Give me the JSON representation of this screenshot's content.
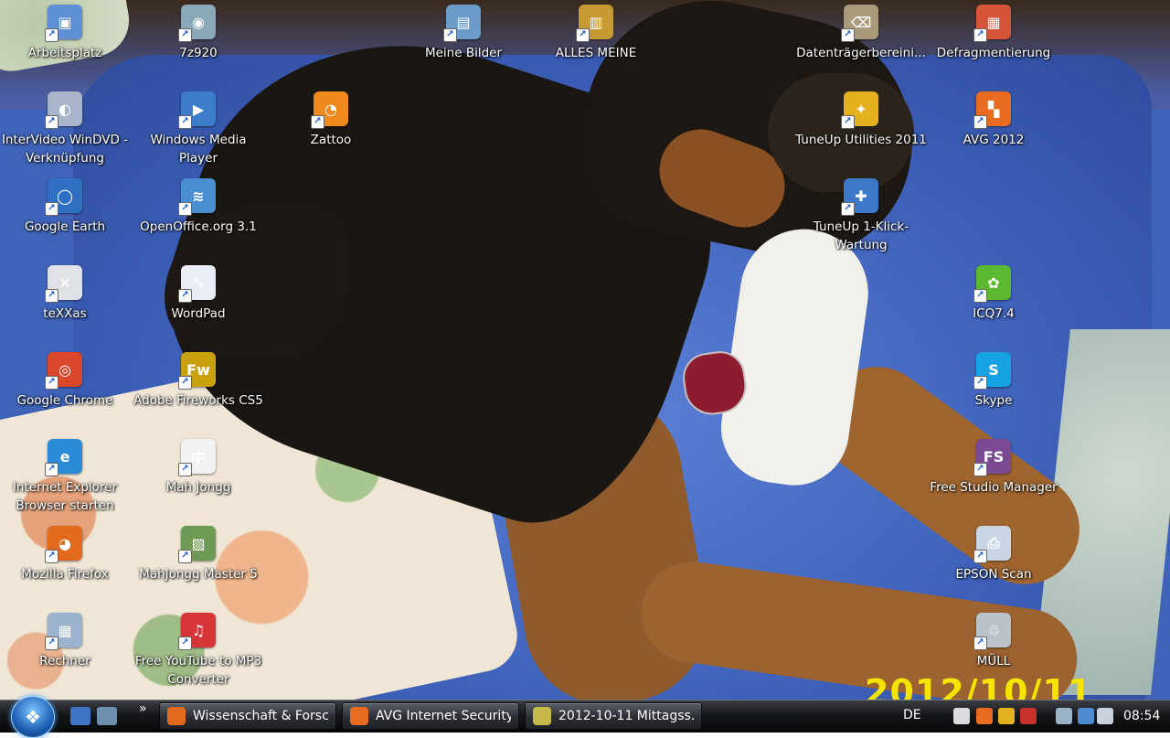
{
  "desktop": {
    "icons": [
      {
        "label": "Arbeitsplatz",
        "icon": "computer-icon",
        "color": "#5f8fd4",
        "glyph": "▣"
      },
      {
        "label": "7z920",
        "icon": "archive-installer-icon",
        "color": "#8aa8b8",
        "glyph": "◉"
      },
      {
        "label": "Meine Bilder",
        "icon": "pictures-folder-icon",
        "color": "#6a9bc9",
        "glyph": "▤"
      },
      {
        "label": "ALLES MEINE",
        "icon": "folder-icon",
        "color": "#c79a34",
        "glyph": "▥"
      },
      {
        "label": "Datenträgerbereini...",
        "icon": "disk-cleanup-icon",
        "color": "#a99a7c",
        "glyph": "⌫"
      },
      {
        "label": "Defragmentierung",
        "icon": "defragment-icon",
        "color": "#d6553a",
        "glyph": "▦"
      },
      {
        "label": "InterVideo WinDVD - Verknüpfung",
        "icon": "dvd-player-icon",
        "color": "#a7b4c9",
        "glyph": "◐"
      },
      {
        "label": "Windows Media Player",
        "icon": "media-player-icon",
        "color": "#3d7cc9",
        "glyph": "▶"
      },
      {
        "label": "Zattoo",
        "icon": "tv-icon",
        "color": "#f08a1c",
        "glyph": "◔"
      },
      {
        "label": "TuneUp Utilities 2011",
        "icon": "tuneup-icon",
        "color": "#e3b21e",
        "glyph": "✦"
      },
      {
        "label": "AVG 2012",
        "icon": "antivirus-icon",
        "color": "#e86b1f",
        "glyph": "▚"
      },
      {
        "label": "Google Earth",
        "icon": "globe-icon",
        "color": "#2f6fc4",
        "glyph": "◯"
      },
      {
        "label": "OpenOffice.org 3.1",
        "icon": "office-suite-icon",
        "color": "#4a8fd1",
        "glyph": "≋"
      },
      {
        "label": "TuneUp 1-Klick-Wartung",
        "icon": "maintenance-icon",
        "color": "#3d78c9",
        "glyph": "✚"
      },
      {
        "label": "teXXas",
        "icon": "texxas-icon",
        "color": "#dfe3e8",
        "glyph": "✕"
      },
      {
        "label": "WordPad",
        "icon": "wordpad-icon",
        "color": "#e9eef6",
        "glyph": "✎"
      },
      {
        "label": "ICQ7.4",
        "icon": "icq-flower-icon",
        "color": "#5cb82e",
        "glyph": "✿"
      },
      {
        "label": "Google Chrome",
        "icon": "chrome-icon",
        "color": "#d9482b",
        "glyph": "◎"
      },
      {
        "label": "Adobe Fireworks CS5",
        "icon": "fireworks-icon",
        "color": "#c9a10f",
        "glyph": "Fw"
      },
      {
        "label": "Skype",
        "icon": "skype-icon",
        "color": "#17a2e4",
        "glyph": "S"
      },
      {
        "label": "Internet Explorer Browser starten",
        "icon": "internet-explorer-icon",
        "color": "#2b8ad6",
        "glyph": "e"
      },
      {
        "label": "Mah Jongg",
        "icon": "mahjong-tile-icon",
        "color": "#f2f2f2",
        "glyph": "中"
      },
      {
        "label": "Free Studio Manager",
        "icon": "free-studio-icon",
        "color": "#7a4a93",
        "glyph": "FS"
      },
      {
        "label": "Mozilla Firefox",
        "icon": "firefox-icon",
        "color": "#e16a1c",
        "glyph": "◕"
      },
      {
        "label": "MahJongg Master 5",
        "icon": "mahjongg-master-icon",
        "color": "#6f9a55",
        "glyph": "▨"
      },
      {
        "label": "EPSON Scan",
        "icon": "scanner-icon",
        "color": "#c9d6e6",
        "glyph": "⎙"
      },
      {
        "label": "Rechner",
        "icon": "calculator-icon",
        "color": "#9bb3cc",
        "glyph": "▦"
      },
      {
        "label": "Free YouTube to MP3 Converter",
        "icon": "youtube-mp3-icon",
        "color": "#d6363a",
        "glyph": "♫"
      },
      {
        "label": "MÜLL",
        "icon": "recycle-bin-icon",
        "color": "#b9c1c9",
        "glyph": "♲"
      }
    ]
  },
  "wallpaper": {
    "date_stamp": "2012/10/11"
  },
  "taskbar": {
    "start_icon": "windows-logo-icon",
    "quick_launch": [
      {
        "icon": "show-desktop-icon",
        "color": "#3d74c6"
      },
      {
        "icon": "switch-windows-icon",
        "color": "#6f8fae"
      }
    ],
    "overflow": "»",
    "tasks": [
      {
        "label": "Wissenschaft & Forsc...",
        "icon": "firefox-icon",
        "color": "#e16a1c"
      },
      {
        "label": "AVG Internet Security...",
        "icon": "antivirus-icon",
        "color": "#e86b1f"
      },
      {
        "label": "2012-10-11 Mittagss...",
        "icon": "folder-icon",
        "color": "#c6b94a"
      }
    ],
    "language": "DE",
    "tray": [
      {
        "icon": "texxas-tray-icon",
        "color": "#d9dde2"
      },
      {
        "icon": "avg-tray-icon",
        "color": "#e86b1f"
      },
      {
        "icon": "tuneup-tray-icon",
        "color": "#e3b21e"
      },
      {
        "icon": "speaker-mute-icon",
        "color": "#c9312b"
      },
      {
        "icon": "safely-remove-icon",
        "color": "#9ab2c6"
      },
      {
        "icon": "network-icon",
        "color": "#4f8bd0"
      },
      {
        "icon": "volume-icon",
        "color": "#c8d2dc"
      }
    ],
    "clock": "08:54"
  }
}
